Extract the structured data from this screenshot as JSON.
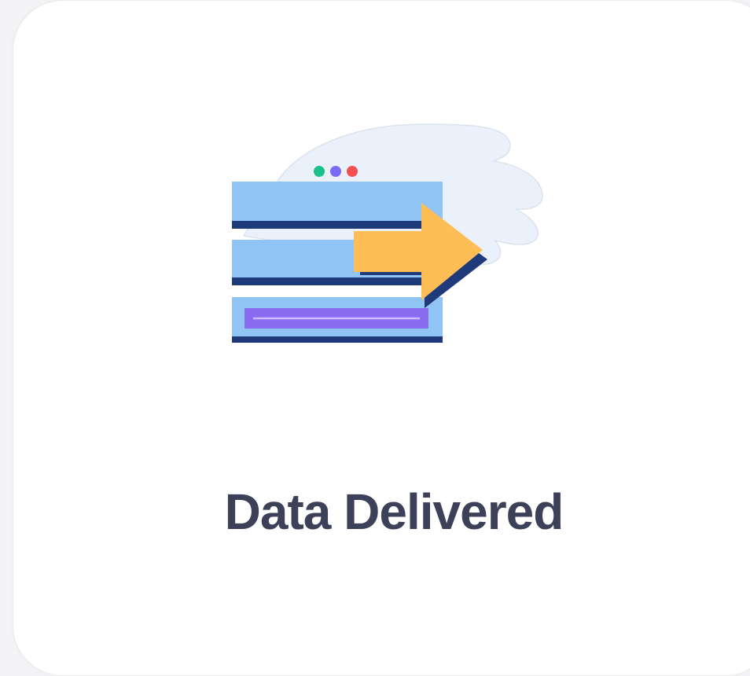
{
  "card": {
    "title": "Data Delivered",
    "illustration": "data-transfer-illustration",
    "colors": {
      "title": "#3c4058",
      "cloud": "#eaf1fb",
      "bar_fill": "#90c4f5",
      "bar_shadow": "#1e3a7a",
      "arrow": "#ffbe55",
      "accent_bar": "#8a6cf2",
      "dot_green": "#1cc08a",
      "dot_purple": "#7a6af5",
      "dot_red": "#f45050"
    }
  }
}
